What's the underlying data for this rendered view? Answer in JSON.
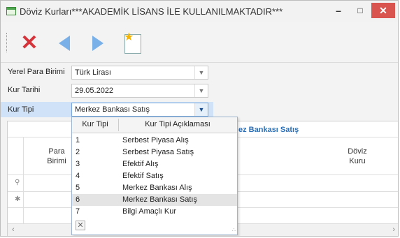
{
  "window": {
    "title": "Döviz Kurları***AKADEMİK LİSANS İLE KULLANILMAKTADIR***",
    "controls": {
      "minimize": "–",
      "maximize": "□",
      "close": "✕"
    }
  },
  "toolbar": {
    "items": [
      {
        "name": "delete",
        "icon": "red-x-icon"
      },
      {
        "name": "previous",
        "icon": "left-arrow-icon"
      },
      {
        "name": "next",
        "icon": "right-arrow-icon"
      },
      {
        "name": "wizard",
        "icon": "document-star-icon"
      }
    ]
  },
  "form": {
    "local_currency_label": "Yerel Para Birimi",
    "local_currency_value": "Türk Lirası",
    "rate_date_label": "Kur Tarihi",
    "rate_date_value": "29.05.2022",
    "rate_type_label": "Kur Tipi",
    "rate_type_value": "Merkez Bankası Satış"
  },
  "grid": {
    "title": "ez Bankası Satış",
    "col_currency": "Para\nBirimi",
    "col_rate": "Döviz\nKuru"
  },
  "dropdown": {
    "header_code": "Kur Tipi",
    "header_desc": "Kur Tipi Açıklaması",
    "options": [
      {
        "code": "1",
        "desc": "Serbest Piyasa Alış"
      },
      {
        "code": "2",
        "desc": "Serbest Piyasa Satış"
      },
      {
        "code": "3",
        "desc": "Efektif Alış"
      },
      {
        "code": "4",
        "desc": "Efektif Satış"
      },
      {
        "code": "5",
        "desc": "Merkez Bankası Alış"
      },
      {
        "code": "6",
        "desc": "Merkez Bankası Satış"
      },
      {
        "code": "7",
        "desc": "Bilgi Amaçlı Kur"
      }
    ],
    "selected_code": "6"
  },
  "colors": {
    "accent": "#2a6fb8",
    "close": "#d9534f",
    "highlight": "#cfe2f7"
  }
}
